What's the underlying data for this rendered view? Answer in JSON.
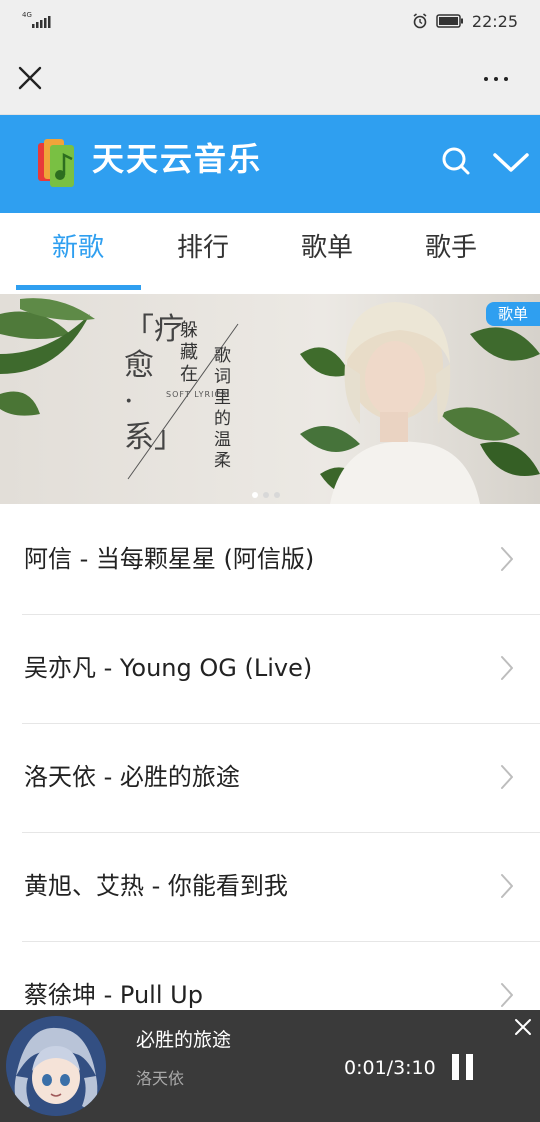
{
  "status_bar": {
    "network": "4G",
    "time": "22:25",
    "icons": [
      "signal-icon",
      "alarm-icon",
      "battery-icon"
    ]
  },
  "nav": {
    "close_icon": "close-icon",
    "more_icon": "more-icon"
  },
  "app": {
    "title": "天天云音乐",
    "accent_color": "#2f9ff0"
  },
  "tabs": [
    {
      "label": "新歌",
      "active": true
    },
    {
      "label": "排行",
      "active": false
    },
    {
      "label": "歌单",
      "active": false
    },
    {
      "label": "歌手",
      "active": false
    }
  ],
  "banner": {
    "tag": "歌单",
    "heal": "「疗愈·系」",
    "hide": "躲藏在",
    "soft": "SOFT LYRICS",
    "lyric": "歌词里的温柔",
    "slide_count": 3,
    "active_slide": 0
  },
  "songs": [
    {
      "title": "阿信 - 当每颗星星 (阿信版)"
    },
    {
      "title": "吴亦凡 - Young OG (Live)"
    },
    {
      "title": "洛天依 - 必胜的旅途"
    },
    {
      "title": "黄旭、艾热 - 你能看到我"
    },
    {
      "title": "蔡徐坤 - Pull Up"
    }
  ],
  "player": {
    "song": "必胜的旅途",
    "artist": "洛天依",
    "time": "0:01/3:10",
    "state": "playing"
  }
}
